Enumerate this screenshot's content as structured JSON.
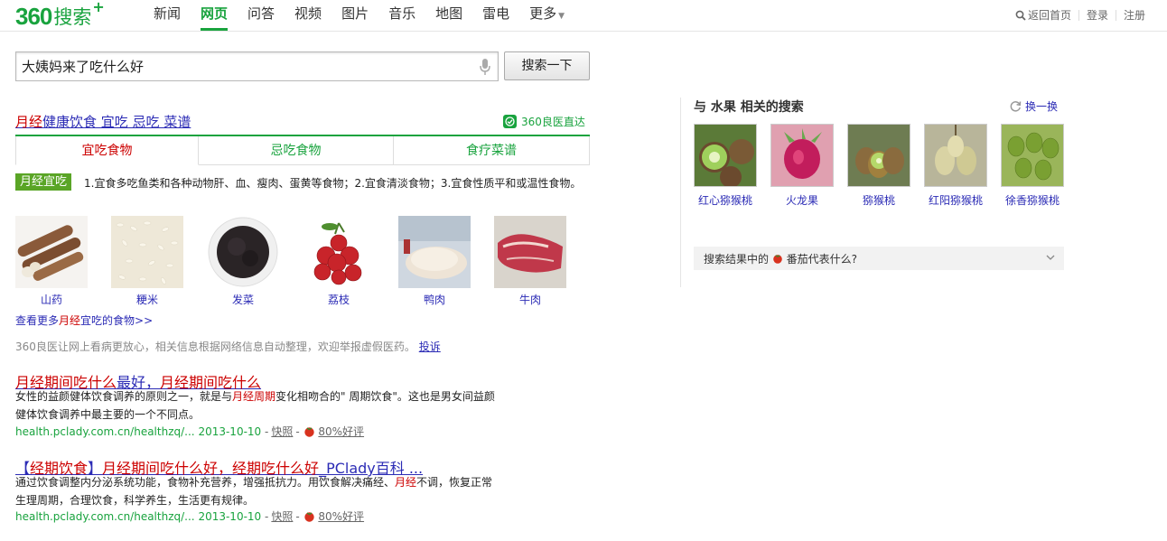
{
  "logo": {
    "num": "360",
    "word": "搜索",
    "plus": "+"
  },
  "nav": [
    {
      "label": "新闻"
    },
    {
      "label": "网页",
      "active": true
    },
    {
      "label": "问答"
    },
    {
      "label": "视频"
    },
    {
      "label": "图片"
    },
    {
      "label": "音乐"
    },
    {
      "label": "地图"
    },
    {
      "label": "雷电"
    },
    {
      "label": "更多"
    }
  ],
  "toplinks": {
    "home": "返回首页",
    "login": "登录",
    "register": "注册"
  },
  "search": {
    "value": "大姨妈来了吃什么好",
    "button": "搜索一下"
  },
  "health": {
    "title_hl": "月经",
    "title_rest": "健康饮食  宜吃  忌吃  菜谱",
    "badge": "360良医直达",
    "tabs": [
      "宜吃食物",
      "忌吃食物",
      "食疗菜谱"
    ],
    "tag": "月经宜吃",
    "desc": "1.宜食多吃鱼类和各种动物肝、血、瘦肉、蛋黄等食物；2.宜食清淡食物；3.宜食性质平和或温性食物。",
    "foods": [
      "山药",
      "粳米",
      "发菜",
      "荔枝",
      "鸭肉",
      "牛肉"
    ],
    "more_prefix": "查看更多",
    "more_hl": "月经",
    "more_suffix": "宜吃的食物>>",
    "disclaimer": "360良医让网上看病更放心，相关信息根据网络信息自动整理，欢迎举报虚假医药。",
    "report": "投诉"
  },
  "results": [
    {
      "title_parts": [
        {
          "t": "月经期间吃什么",
          "hl": true
        },
        {
          "t": "最好，",
          "hl": false
        },
        {
          "t": "月经期间吃什么",
          "hl": true
        }
      ],
      "desc_parts": [
        {
          "t": "女性的益颜健体饮食调养的原则之一，就是与",
          "hl": false
        },
        {
          "t": "月经周期",
          "hl": true
        },
        {
          "t": "变化相吻合的\" 周期饮食\"。这也是男女间益颜健体饮食调养中最主要的一个不同点。",
          "hl": false
        }
      ],
      "url": "health.pclady.com.cn/healthzq/...",
      "date": "2013-10-10",
      "snapshot": "快照",
      "rating": "80%好评"
    },
    {
      "title_parts": [
        {
          "t": "【",
          "hl": false
        },
        {
          "t": "经期饮食",
          "hl": true
        },
        {
          "t": "】",
          "hl": false
        },
        {
          "t": "月经期间吃什么好，经期吃什么好",
          "hl": true
        },
        {
          "t": "_PClady百科 ...",
          "hl": false
        }
      ],
      "desc_parts": [
        {
          "t": "通过饮食调整内分泌系统功能，食物补充营养，增强抵抗力。用饮食解决痛经、",
          "hl": false
        },
        {
          "t": "月经",
          "hl": true
        },
        {
          "t": "不调，恢复正常生理周期，合理饮食，科学养生，生活更有规律。",
          "hl": false
        }
      ],
      "url": "health.pclady.com.cn/healthzq/...",
      "date": "2013-10-10",
      "snapshot": "快照",
      "rating": "80%好评"
    }
  ],
  "related": {
    "title": "与 水果 相关的搜索",
    "refresh": "换一换",
    "items": [
      "红心猕猴桃",
      "火龙果",
      "猕猴桃",
      "红阳猕猴桃",
      "徐香猕猴桃"
    ]
  },
  "tomato_bar": {
    "prefix": "搜索结果中的",
    "suffix": "番茄代表什么?"
  },
  "colors": {
    "brand_green": "#19a33e",
    "link_blue": "#2b2bb5",
    "highlight_red": "#cc0000"
  }
}
